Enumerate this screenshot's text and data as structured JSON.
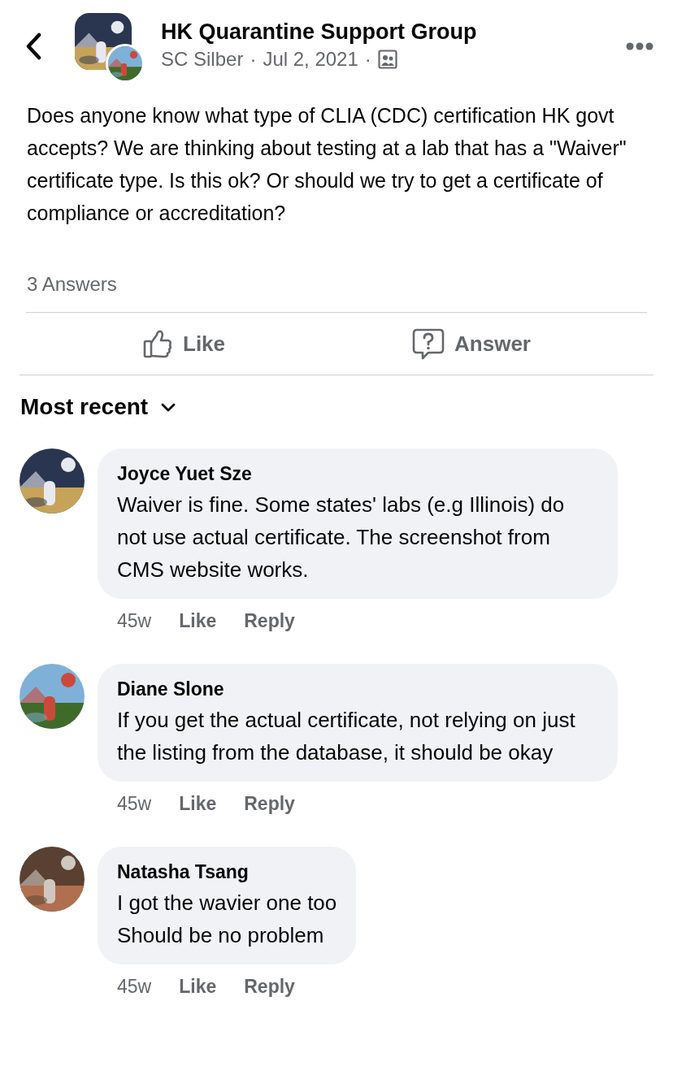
{
  "header": {
    "group_name": "HK Quarantine Support Group",
    "author": "SC Silber",
    "date": "Jul 2, 2021",
    "separator": "·"
  },
  "post": {
    "text": "Does anyone know what type of CLIA (CDC) certification HK govt accepts? We are thinking about testing at a lab that has a \"Waiver\" certificate type. Is this ok? Or should we try to get a certificate of compliance or accreditation?",
    "answers_count": "3 Answers"
  },
  "actions": [
    {
      "kind": "like",
      "label": "Like"
    },
    {
      "kind": "answer",
      "label": "Answer"
    }
  ],
  "sort": {
    "label": "Most recent"
  },
  "comments": [
    {
      "name": "Joyce Yuet Sze",
      "text": "Waiver is fine. Some states' labs (e.g Illinois) do not use actual certificate. The screenshot from CMS website works.",
      "age": "45w",
      "like": "Like",
      "reply": "Reply"
    },
    {
      "name": "Diane Slone",
      "text": "If you get the actual certificate, not relying on just the listing from the database, it should be okay",
      "age": "45w",
      "like": "Like",
      "reply": "Reply"
    },
    {
      "name": "Natasha Tsang",
      "text": "I got the wavier one too\nShould be no problem",
      "age": "45w",
      "like": "Like",
      "reply": "Reply"
    }
  ]
}
